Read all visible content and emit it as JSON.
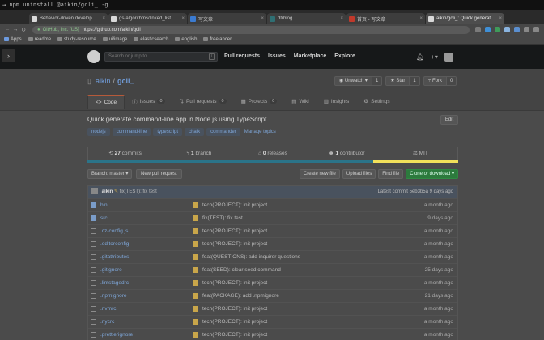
{
  "terminal": {
    "command": "→  npm uninstall @aikin/gcli_ -g"
  },
  "tabs": [
    {
      "title": "Behavior-driven develop",
      "favicon_color": "#d9d9d9",
      "active": false
    },
    {
      "title": "gs-algorithms/linked_list...",
      "favicon_color": "#d9d9d9",
      "active": false
    },
    {
      "title": "写文章",
      "favicon_color": "#3b7bd1",
      "active": false
    },
    {
      "title": "dtrblog",
      "favicon_color": "#2f6f73",
      "active": false
    },
    {
      "title": "首页 - 写文章",
      "favicon_color": "#c0392b",
      "active": false
    },
    {
      "title": "aikin/gcli_: Quick generat",
      "favicon_color": "#d9d9d9",
      "active": true
    }
  ],
  "omnibox": {
    "org": "GitHub, Inc. [US]",
    "url": "https://github.com/aikin/gcli_"
  },
  "bookmarks": [
    "Apps",
    "readme",
    "study-resource",
    "ui/image",
    "elasticsearch",
    "english",
    "freelancer"
  ],
  "gh_header": {
    "search_placeholder": "Search or jump to...",
    "slash": "/",
    "nav": [
      "Pull requests",
      "Issues",
      "Marketplace",
      "Explore"
    ]
  },
  "repo": {
    "owner": "aikin",
    "name": "gcli_",
    "sep": "/",
    "watch": {
      "label": "◉ Unwatch ▾",
      "count": "1"
    },
    "star": {
      "label": "★ Star",
      "count": "1"
    },
    "fork": {
      "label": "⑂ Fork",
      "count": "0"
    },
    "tabs": [
      {
        "label": "Code",
        "icon": "<>",
        "count": null,
        "selected": true
      },
      {
        "label": "Issues",
        "icon": "ⓘ",
        "count": "0",
        "selected": false
      },
      {
        "label": "Pull requests",
        "icon": "⇅",
        "count": "0",
        "selected": false
      },
      {
        "label": "Projects",
        "icon": "▦",
        "count": "0",
        "selected": false
      },
      {
        "label": "Wiki",
        "icon": "▤",
        "count": null,
        "selected": false
      },
      {
        "label": "Insights",
        "icon": "▥",
        "count": null,
        "selected": false
      },
      {
        "label": "Settings",
        "icon": "⚙",
        "count": null,
        "selected": false
      }
    ],
    "description": "Quick generate command-line app in Node.js using TypeScript.",
    "edit_label": "Edit",
    "topics": [
      "nodejs",
      "command-line",
      "typescript",
      "chalk",
      "commander",
      "Manage topics"
    ],
    "summary": [
      {
        "icon": "⟲",
        "num": "27",
        "label": "commits"
      },
      {
        "icon": "⑂",
        "num": "1",
        "label": "branch"
      },
      {
        "icon": "⌂",
        "num": "0",
        "label": "releases"
      },
      {
        "icon": "☻",
        "num": "1",
        "label": "contributor"
      },
      {
        "icon": "⚖",
        "num": "",
        "label": "MIT"
      }
    ],
    "lang_colors": [
      "#2b7489",
      "#f1e05a"
    ],
    "branch_label": "Branch: master ▾",
    "new_pr_label": "New pull request",
    "file_buttons": [
      "Create new file",
      "Upload files",
      "Find file",
      "Clone or download ▾"
    ],
    "latest_commit": {
      "user": "aikin",
      "message": "fix(TEST): fix test",
      "meta": "Latest commit 5eb3b5a 9 days ago"
    },
    "files": [
      {
        "name": "bin",
        "type": "folder",
        "message": "tech(PROJECT): init project",
        "age": "a month ago"
      },
      {
        "name": "src",
        "type": "folder",
        "message": "fix(TEST): fix test",
        "age": "9 days ago"
      },
      {
        "name": ".cz-config.js",
        "type": "file",
        "message": "tech(PROJECT): init project",
        "age": "a month ago"
      },
      {
        "name": ".editorconfig",
        "type": "file",
        "message": "tech(PROJECT): init project",
        "age": "a month ago"
      },
      {
        "name": ".gitattributes",
        "type": "file",
        "message": "feat(QUESTIONS): add inquirer questions",
        "age": "a month ago"
      },
      {
        "name": ".gitignore",
        "type": "file",
        "message": "feat(SEED): clear seed command",
        "age": "25 days ago"
      },
      {
        "name": ".lintstagedrc",
        "type": "file",
        "message": "tech(PROJECT): init project",
        "age": "a month ago"
      },
      {
        "name": ".npmignore",
        "type": "file",
        "message": "feat(PACKAGE): add .npmignore",
        "age": "21 days ago"
      },
      {
        "name": ".nvmrc",
        "type": "file",
        "message": "tech(PROJECT): init project",
        "age": "a month ago"
      },
      {
        "name": ".nycrc",
        "type": "file",
        "message": "tech(PROJECT): init project",
        "age": "a month ago"
      },
      {
        "name": ".prettierignore",
        "type": "file",
        "message": "tech(PROJECT): init project",
        "age": "a month ago"
      }
    ]
  }
}
